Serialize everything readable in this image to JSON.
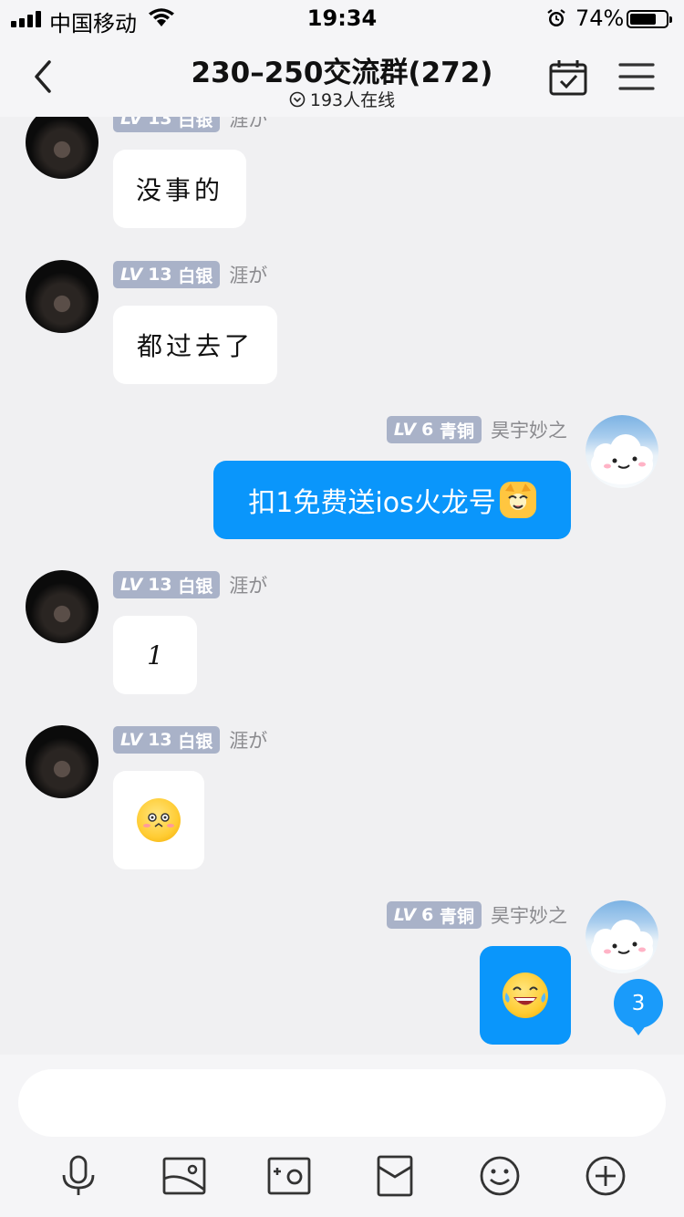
{
  "status_bar": {
    "carrier": "中国移动",
    "time": "19:34",
    "battery": "74%",
    "battery_level": 0.74
  },
  "header": {
    "title": "230–250交流群(272)",
    "online": "193人在线",
    "back_icon": "chevron-left-icon",
    "calendar_icon": "calendar-check-icon",
    "menu_icon": "menu-icon"
  },
  "messages": [
    {
      "direction": "in",
      "level": "LV",
      "level_num": "13",
      "rank": "白银",
      "sender": "涯が",
      "text": "没事的"
    },
    {
      "direction": "in",
      "level": "LV",
      "level_num": "13",
      "rank": "白银",
      "sender": "涯が",
      "text": "都过去了"
    },
    {
      "direction": "out",
      "level": "LV",
      "level_num": "6",
      "rank": "青铜",
      "sender": "昊宇妙之",
      "text": "扣1免费送ios火龙号",
      "emoji": "cat-face-emoji"
    },
    {
      "direction": "in",
      "level": "LV",
      "level_num": "13",
      "rank": "白银",
      "sender": "涯が",
      "text": "1"
    },
    {
      "direction": "in",
      "level": "LV",
      "level_num": "13",
      "rank": "白银",
      "sender": "涯が",
      "emoji": "shy-face-emoji"
    },
    {
      "direction": "out",
      "level": "LV",
      "level_num": "6",
      "rank": "青铜",
      "sender": "昊宇妙之",
      "emoji": "laughing-tears-emoji"
    }
  ],
  "unread_count": "3",
  "toolbar": [
    "microphone-icon",
    "image-icon",
    "camera-icon",
    "red-packet-icon",
    "emoji-icon",
    "plus-icon"
  ],
  "colors": {
    "accent": "#0a96fb",
    "badge": "#a9b2c8",
    "background": "#f0f0f2"
  }
}
